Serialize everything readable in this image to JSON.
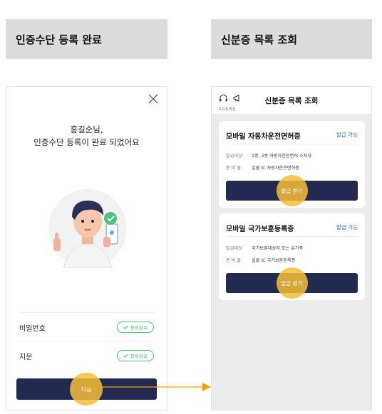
{
  "left_header": {
    "title": "인증수단 등록 완료"
  },
  "right_header": {
    "title": "신분증 목록 조회"
  },
  "left_screen": {
    "greeting_line1": "홍길순님,",
    "greeting_line2": "인증수단 등록이 완료 되었어요",
    "rows": [
      {
        "label": "비밀번호",
        "badge": "등록완료"
      },
      {
        "label": "지문",
        "badge": "등록완료"
      }
    ],
    "next_button": "다음"
  },
  "right_screen": {
    "title": "신분증 목록 조회",
    "version": "2.0.6 최신",
    "cards": [
      {
        "title": "모바일 자동차운전면허증",
        "status": "발급 가능",
        "target_label": "발급대상",
        "target_value": "1종, 2종 자동차운전면허 소지자",
        "prep_label": "준 비 물",
        "prep_value": "실물 IC 자동차운전면허증",
        "button": "발급 받기"
      },
      {
        "title": "모바일 국가보훈등록증",
        "status": "발급 가능",
        "target_label": "발급대상",
        "target_value": "국가보훈대상자 또는 유가족",
        "prep_label": "준 비 물",
        "prep_value": "실물 IC 국가보훈등록증",
        "button": "발급 받기"
      }
    ]
  },
  "colors": {
    "header_bg": "#dcdcdc",
    "button_navy": "#232a52",
    "highlight": "#f6be37",
    "success_green": "#4fbf7a",
    "link_blue": "#2c6fd6",
    "arrow": "#f0a800"
  },
  "icons": [
    "close-icon",
    "check-icon",
    "headset-icon",
    "megaphone-icon",
    "arrow-right-icon"
  ]
}
